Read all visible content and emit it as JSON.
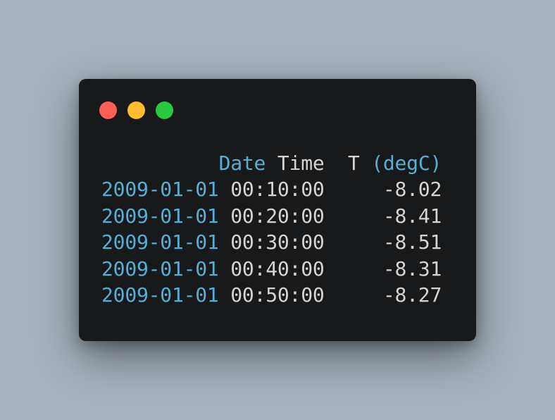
{
  "window": {
    "controls": [
      {
        "name": "close",
        "color": "#ff5f57"
      },
      {
        "name": "minimize",
        "color": "#febc2e"
      },
      {
        "name": "maximize",
        "color": "#28c840"
      }
    ],
    "colors": {
      "background": "#18191b",
      "accent": "#56afd7",
      "text": "#d4d4d4"
    }
  },
  "table": {
    "header": {
      "date": "Date",
      "time": "Time",
      "temp_name": "T",
      "temp_unit": "(degC)"
    },
    "rows": [
      {
        "date": "2009-01-01",
        "time": "00:10:00",
        "temp": "-8.02"
      },
      {
        "date": "2009-01-01",
        "time": "00:20:00",
        "temp": "-8.41"
      },
      {
        "date": "2009-01-01",
        "time": "00:30:00",
        "temp": "-8.51"
      },
      {
        "date": "2009-01-01",
        "time": "00:40:00",
        "temp": "-8.31"
      },
      {
        "date": "2009-01-01",
        "time": "00:50:00",
        "temp": "-8.27"
      }
    ]
  }
}
